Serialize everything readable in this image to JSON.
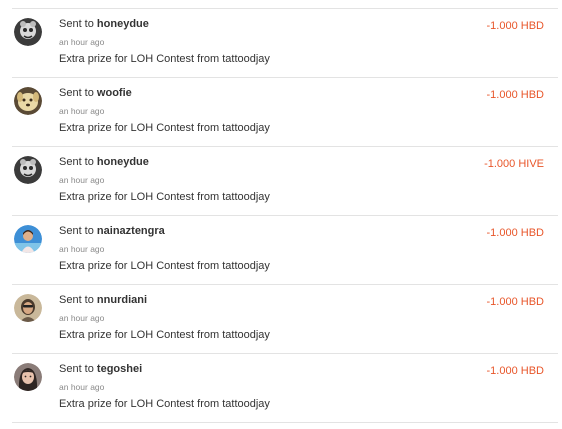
{
  "transfers": [
    {
      "prefix": "Sent to",
      "user": "honeydue",
      "time": "an hour ago",
      "memo": "Extra prize for LOH Contest from tattoodjay",
      "amount": "-1.000 HBD",
      "avatar_icon": "honeydue-avatar-icon"
    },
    {
      "prefix": "Sent to",
      "user": "woofie",
      "time": "an hour ago",
      "memo": "Extra prize for LOH Contest from tattoodjay",
      "amount": "-1.000 HBD",
      "avatar_icon": "woofie-avatar-icon"
    },
    {
      "prefix": "Sent to",
      "user": "honeydue",
      "time": "an hour ago",
      "memo": "Extra prize for LOH Contest from tattoodjay",
      "amount": "-1.000 HIVE",
      "avatar_icon": "honeydue-avatar-icon"
    },
    {
      "prefix": "Sent to",
      "user": "nainaztengra",
      "time": "an hour ago",
      "memo": "Extra prize for LOH Contest from tattoodjay",
      "amount": "-1.000 HBD",
      "avatar_icon": "nainaztengra-avatar-icon"
    },
    {
      "prefix": "Sent to",
      "user": "nnurdiani",
      "time": "an hour ago",
      "memo": "Extra prize for LOH Contest from tattoodjay",
      "amount": "-1.000 HBD",
      "avatar_icon": "nnurdiani-avatar-icon"
    },
    {
      "prefix": "Sent to",
      "user": "tegoshei",
      "time": "an hour ago",
      "memo": "Extra prize for LOH Contest from tattoodjay",
      "amount": "-1.000 HBD",
      "avatar_icon": "tegoshei-avatar-icon"
    }
  ],
  "colors": {
    "amount_negative": "#e8562a",
    "divider": "#e3e3e3",
    "timestamp": "#8a8a8a"
  }
}
